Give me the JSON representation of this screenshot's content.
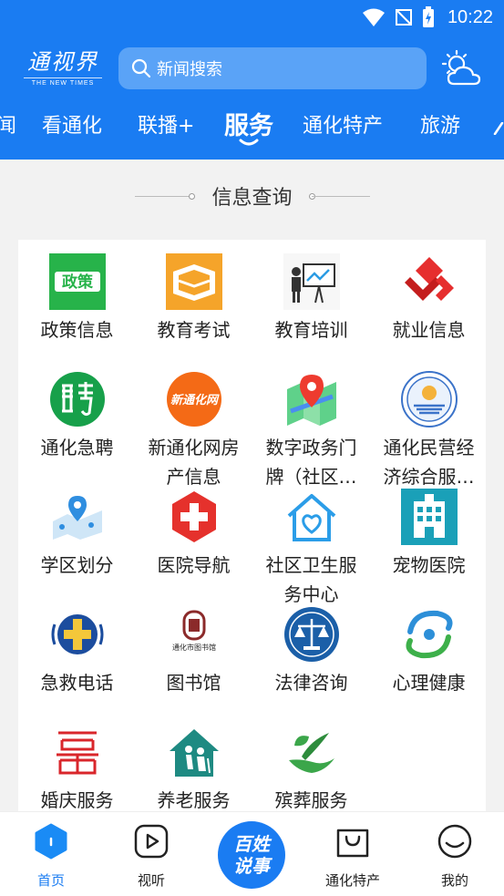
{
  "status_bar": {
    "time": "10:22"
  },
  "header": {
    "logo_title": "通视界",
    "logo_subtitle": "THE NEW TIMES",
    "search_placeholder": "新闻搜索",
    "tabs": [
      {
        "label": "闻"
      },
      {
        "label": "看通化"
      },
      {
        "label": "联播+"
      },
      {
        "label": "服务"
      },
      {
        "label": "通化特产"
      },
      {
        "label": "旅游"
      }
    ],
    "active_tab": "服务"
  },
  "section": {
    "title": "信息查询"
  },
  "services": [
    {
      "label": "政策信息",
      "icon": "policy-icon"
    },
    {
      "label": "教育考试",
      "icon": "education-exam-icon"
    },
    {
      "label": "教育培训",
      "icon": "education-training-icon"
    },
    {
      "label": "就业信息",
      "icon": "employment-icon"
    },
    {
      "label": "通化急聘",
      "icon": "urgent-hiring-icon"
    },
    {
      "label": "新通化网房产信息",
      "icon": "real-estate-icon",
      "lines": [
        "新通化网房",
        "产信息"
      ]
    },
    {
      "label": "数字政务门牌（社区…",
      "icon": "map-pin-icon",
      "lines": [
        "数字政务门",
        "牌（社区…"
      ]
    },
    {
      "label": "通化民营经济综合服…",
      "icon": "private-economy-icon",
      "lines": [
        "通化民营经",
        "济综合服…"
      ]
    },
    {
      "label": "学区划分",
      "icon": "school-district-icon"
    },
    {
      "label": "医院导航",
      "icon": "hospital-icon"
    },
    {
      "label": "社区卫生服务中心",
      "icon": "community-health-icon",
      "lines": [
        "社区卫生服",
        "务中心"
      ]
    },
    {
      "label": "宠物医院",
      "icon": "pet-hospital-icon"
    },
    {
      "label": "急救电话",
      "icon": "emergency-icon"
    },
    {
      "label": "图书馆",
      "icon": "library-icon"
    },
    {
      "label": "法律咨询",
      "icon": "legal-icon"
    },
    {
      "label": "心理健康",
      "icon": "mental-health-icon"
    },
    {
      "label": "婚庆服务",
      "icon": "wedding-icon"
    },
    {
      "label": "养老服务",
      "icon": "elderly-care-icon"
    },
    {
      "label": "殡葬服务",
      "icon": "funeral-icon"
    }
  ],
  "icon_text": {
    "policy": "政策",
    "real_estate": "新通化网",
    "library": "通化市图书馆"
  },
  "bottom_nav": {
    "home": "首页",
    "video": "视听",
    "center_line1": "百姓",
    "center_line2": "说事",
    "specialty": "通化特产",
    "me": "我的"
  },
  "colors": {
    "primary": "#1a7cf2",
    "search_bg": "#5aa3f7",
    "background": "#f2f2f2"
  }
}
